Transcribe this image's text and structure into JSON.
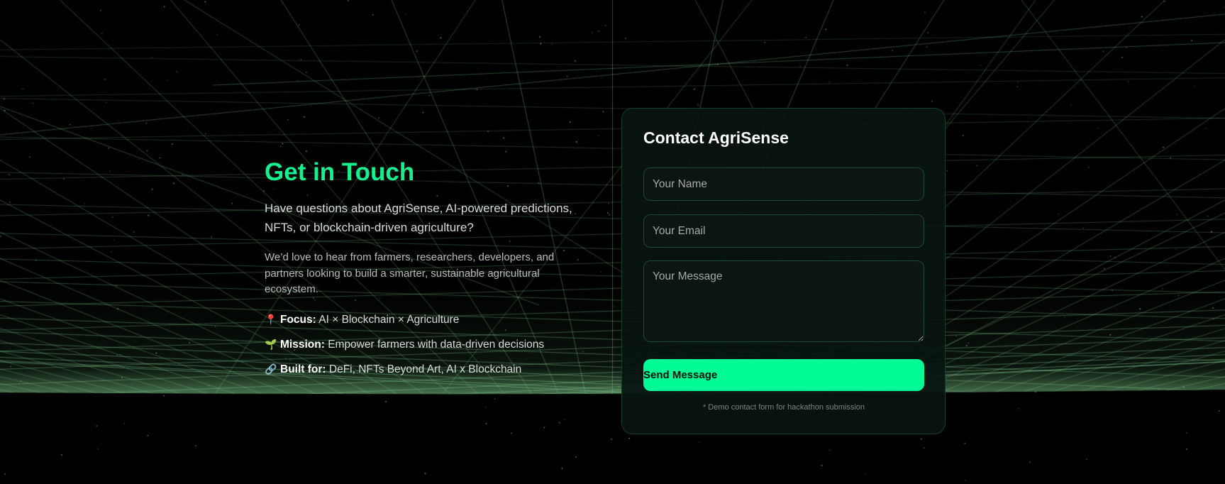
{
  "intro": {
    "title": "Get in Touch",
    "lead": "Have questions about AgriSense, AI-powered predictions, NFTs, or blockchain-driven agriculture?",
    "body": "We’d love to hear from farmers, researchers, developers, and partners looking to build a smarter, sustainable agricultural ecosystem.",
    "facts": [
      {
        "icon": "pin-icon",
        "glyph": "📍",
        "label": "Focus:",
        "value": "AI × Blockchain × Agriculture"
      },
      {
        "icon": "seedling-icon",
        "glyph": "🌱",
        "label": "Mission:",
        "value": "Empower farmers with data-driven decisions"
      },
      {
        "icon": "link-icon",
        "glyph": "🔗",
        "label": "Built for:",
        "value": "DeFi, NFTs Beyond Art, AI x Blockchain"
      }
    ]
  },
  "form": {
    "title": "Contact AgriSense",
    "name_placeholder": "Your Name",
    "email_placeholder": "Your Email",
    "message_placeholder": "Your Message",
    "submit_label": "Send Message",
    "note": "* Demo contact form for hackathon submission"
  },
  "colors": {
    "accent": "#16f08f",
    "button": "#00fa96",
    "grid": "#6fd08a",
    "background": "#000000"
  }
}
